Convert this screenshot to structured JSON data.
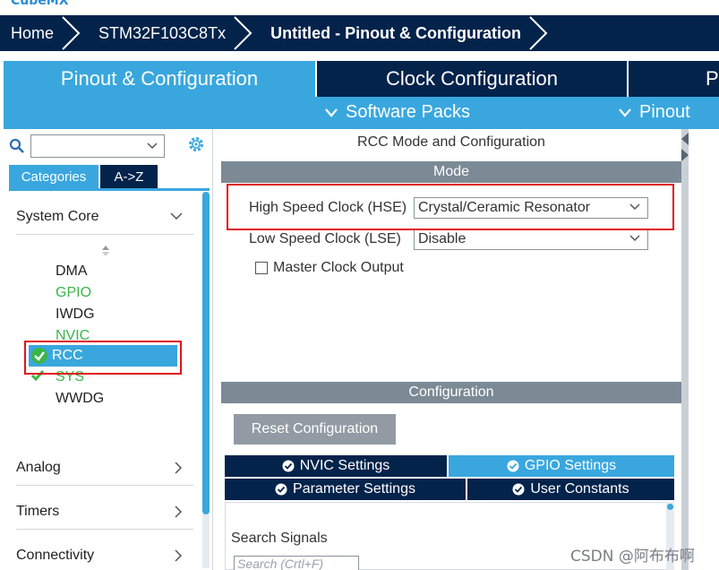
{
  "app": {
    "logo_text": "CubeMX"
  },
  "breadcrumb": {
    "home": "Home",
    "chip": "STM32F103C8Tx",
    "current": "Untitled - Pinout & Configuration"
  },
  "tabs": {
    "pinout": "Pinout & Configuration",
    "clock": "Clock Configuration",
    "project": "P"
  },
  "subbar": {
    "software_packs": "Software Packs",
    "pinout": "Pinout"
  },
  "left": {
    "search_value": "",
    "categories_tab": "Categories",
    "az_tab": "A->Z",
    "groups": {
      "system_core": "System Core",
      "analog": "Analog",
      "timers": "Timers",
      "connectivity": "Connectivity"
    },
    "peripherals": {
      "dma": "DMA",
      "gpio": "GPIO",
      "iwdg": "IWDG",
      "nvic": "NVIC",
      "rcc": "RCC",
      "sys": "SYS",
      "wwdg": "WWDG"
    }
  },
  "center": {
    "title": "RCC Mode and Configuration",
    "mode_header": "Mode",
    "hse_label": "High Speed Clock (HSE)",
    "hse_value": "Crystal/Ceramic Resonator",
    "lse_label": "Low Speed Clock (LSE)",
    "lse_value": "Disable",
    "mco_label": "Master Clock Output",
    "mco_checked": false,
    "config_header": "Configuration",
    "reset_button": "Reset Configuration",
    "config_tabs": {
      "nvic": "NVIC Settings",
      "gpio": "GPIO Settings",
      "parameter": "Parameter Settings",
      "user": "User Constants"
    },
    "search_signals_label": "Search Signals",
    "search_signals_placeholder": "Search (Crtl+F)"
  },
  "colors": {
    "navy": "#03234b",
    "accent": "#39a7de",
    "highlight_red": "#e1121c",
    "enabled_green": "#3ab54a"
  },
  "watermark": "CSDN @阿布布啊"
}
